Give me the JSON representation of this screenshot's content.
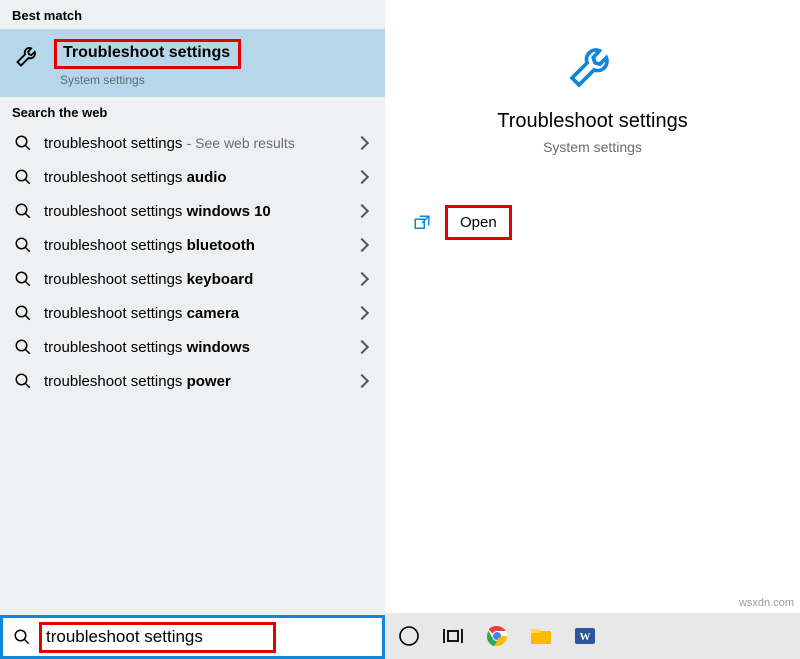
{
  "left": {
    "best_match_header": "Best match",
    "best_match": {
      "title": "Troubleshoot settings",
      "subtitle": "System settings"
    },
    "web_header": "Search the web",
    "web_items": [
      {
        "prefix": "troubleshoot settings",
        "suffix": "",
        "extra": "- See web results"
      },
      {
        "prefix": "troubleshoot settings ",
        "suffix": "audio",
        "extra": ""
      },
      {
        "prefix": "troubleshoot settings ",
        "suffix": "windows 10",
        "extra": ""
      },
      {
        "prefix": "troubleshoot settings ",
        "suffix": "bluetooth",
        "extra": ""
      },
      {
        "prefix": "troubleshoot settings ",
        "suffix": "keyboard",
        "extra": ""
      },
      {
        "prefix": "troubleshoot settings ",
        "suffix": "camera",
        "extra": ""
      },
      {
        "prefix": "troubleshoot settings ",
        "suffix": "windows",
        "extra": ""
      },
      {
        "prefix": "troubleshoot settings ",
        "suffix": "power",
        "extra": ""
      }
    ],
    "search_value": "troubleshoot settings"
  },
  "right": {
    "title": "Troubleshoot settings",
    "subtitle": "System settings",
    "open": "Open"
  },
  "watermark": "wsxdn.com"
}
